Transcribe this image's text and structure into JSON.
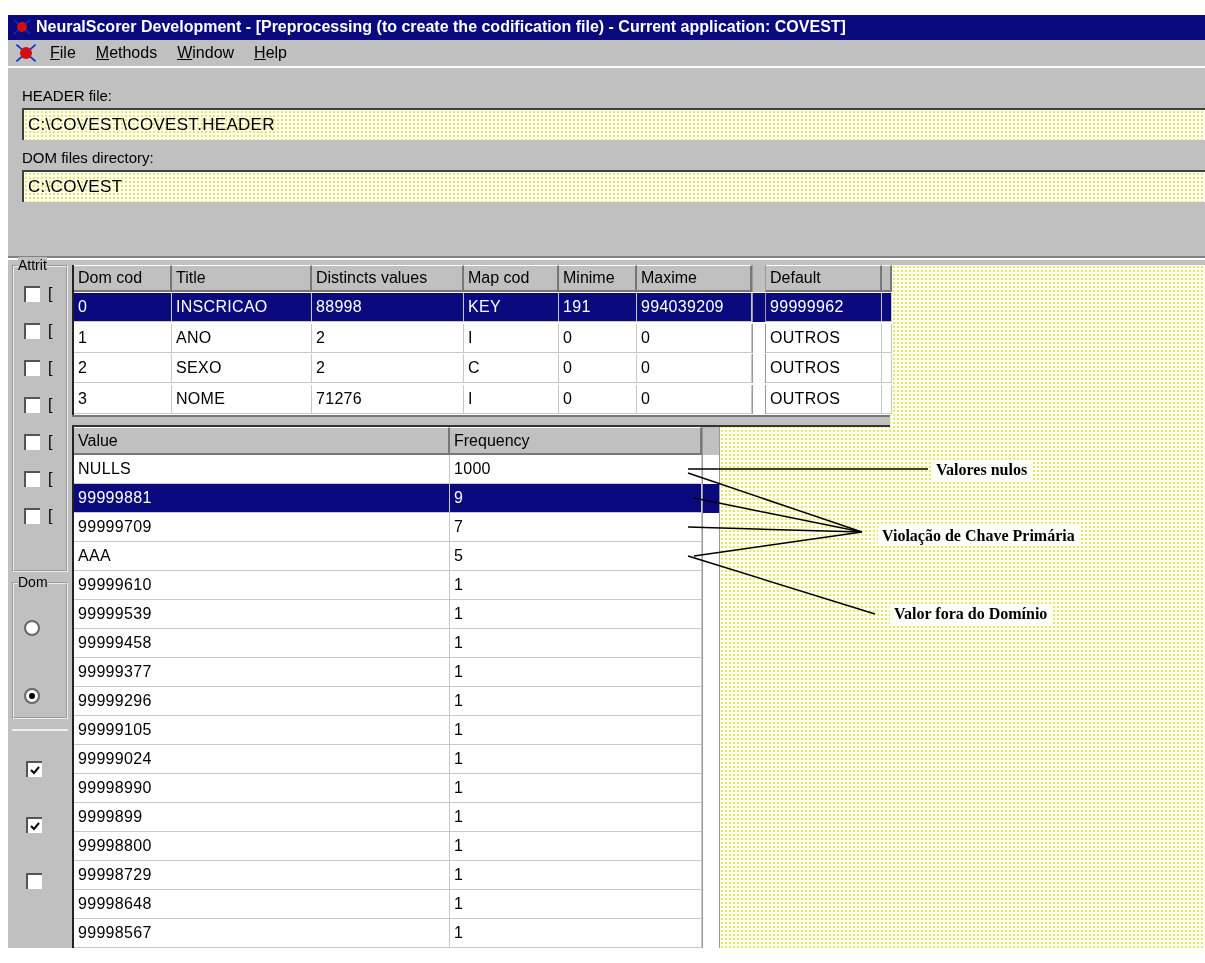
{
  "window": {
    "title": "NeuralScorer Development - [Preprocessing (to create the codification file)  - Current application: COVEST]"
  },
  "menu": [
    "File",
    "Methods",
    "Window",
    "Help"
  ],
  "form": {
    "fields": [
      {
        "label": "HEADER file:",
        "value": "C:\\COVEST\\COVEST.HEADER"
      },
      {
        "label": "DOM files directory:",
        "value": "C:\\COVEST"
      }
    ]
  },
  "left_panel": {
    "groups": [
      {
        "label": "Attrit",
        "items": [
          {
            "kind": "checkbox",
            "label": "[",
            "checked": false
          },
          {
            "kind": "checkbox",
            "label": "[",
            "checked": false
          },
          {
            "kind": "checkbox",
            "label": "[",
            "checked": false
          },
          {
            "kind": "checkbox",
            "label": "[",
            "checked": false
          },
          {
            "kind": "checkbox",
            "label": "[",
            "checked": false
          },
          {
            "kind": "checkbox",
            "label": "[",
            "checked": false
          },
          {
            "kind": "checkbox",
            "label": "[",
            "checked": false
          }
        ]
      },
      {
        "label": "Dom",
        "items": [
          {
            "kind": "radio",
            "selected": false
          },
          {
            "kind": "radio",
            "selected": true
          }
        ]
      }
    ],
    "options": [
      {
        "checked": true
      },
      {
        "checked": true
      },
      {
        "checked": false
      }
    ]
  },
  "domain_table": {
    "columns": [
      "Dom cod",
      "Title",
      "Distincts values",
      "Map cod",
      "Minime",
      "Maxime",
      "Default"
    ],
    "rows": [
      {
        "selected": true,
        "cells": [
          "0",
          "INSCRICAO",
          "88998",
          "KEY",
          "191",
          "994039209",
          "99999962"
        ]
      },
      {
        "selected": false,
        "cells": [
          "1",
          "ANO",
          "2",
          "I",
          "0",
          "0",
          "OUTROS"
        ]
      },
      {
        "selected": false,
        "cells": [
          "2",
          "SEXO",
          "2",
          "C",
          "0",
          "0",
          "OUTROS"
        ]
      },
      {
        "selected": false,
        "cells": [
          "3",
          "NOME",
          "71276",
          "I",
          "0",
          "0",
          "OUTROS"
        ]
      }
    ]
  },
  "frequency_table": {
    "columns": [
      "Value",
      "Frequency"
    ],
    "rows": [
      {
        "selected": false,
        "cells": [
          "NULLS",
          "1000"
        ]
      },
      {
        "selected": true,
        "cells": [
          "99999881",
          "9"
        ]
      },
      {
        "selected": false,
        "cells": [
          "99999709",
          "7"
        ]
      },
      {
        "selected": false,
        "cells": [
          "AAA",
          "5"
        ]
      },
      {
        "selected": false,
        "cells": [
          "99999610",
          "1"
        ]
      },
      {
        "selected": false,
        "cells": [
          "99999539",
          "1"
        ]
      },
      {
        "selected": false,
        "cells": [
          "99999458",
          "1"
        ]
      },
      {
        "selected": false,
        "cells": [
          "99999377",
          "1"
        ]
      },
      {
        "selected": false,
        "cells": [
          "99999296",
          "1"
        ]
      },
      {
        "selected": false,
        "cells": [
          "99999105",
          "1"
        ]
      },
      {
        "selected": false,
        "cells": [
          "99999024",
          "1"
        ]
      },
      {
        "selected": false,
        "cells": [
          "99998990",
          "1"
        ]
      },
      {
        "selected": false,
        "cells": [
          "9999899",
          "1"
        ]
      },
      {
        "selected": false,
        "cells": [
          "99998800",
          "1"
        ]
      },
      {
        "selected": false,
        "cells": [
          "99998729",
          "1"
        ]
      },
      {
        "selected": false,
        "cells": [
          "99998648",
          "1"
        ]
      },
      {
        "selected": false,
        "cells": [
          "99998567",
          "1"
        ]
      }
    ]
  },
  "annotations": [
    {
      "label": "Valores nulos"
    },
    {
      "label": "Violação de Chave Primária"
    },
    {
      "label": "Valor fora do Domínio"
    }
  ]
}
